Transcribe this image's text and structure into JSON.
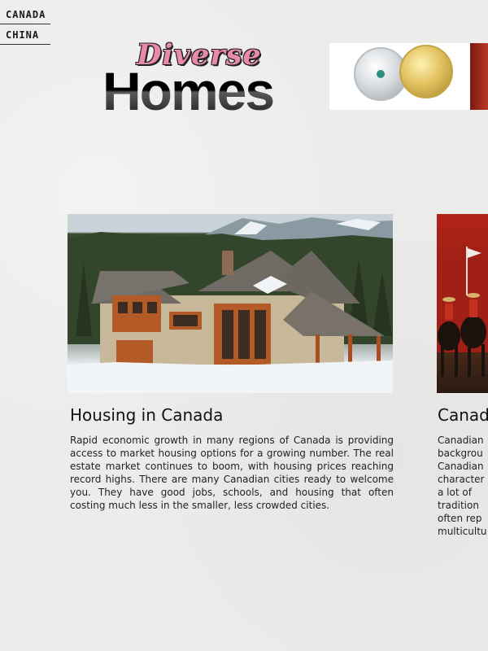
{
  "nav": {
    "items": [
      {
        "label": "CANADA"
      },
      {
        "label": "CHINA"
      }
    ]
  },
  "logo": {
    "script_text": "Diverse",
    "main_text": "Homes",
    "script_color": "#e88aa8"
  },
  "cards": [
    {
      "title": "Housing in Canada",
      "image_icon": "house-photo",
      "body": "Rapid economic growth in many regions of Canada is providing access to market housing options for a growing number. The real estate market continues to boom, with housing prices reaching record highs. There are many Canadian cities ready to welcome you. They have good jobs, schools, and housing that often costing much less in the smaller, less crowded cities."
    },
    {
      "title": "Canad",
      "image_icon": "mounties-photo",
      "lines": [
        "Canadian",
        "backgrou",
        "Canadian",
        "character",
        "a lot of",
        "tradition",
        "often rep",
        "multicultu"
      ]
    }
  ],
  "colors": {
    "background": "#ececea",
    "text": "#222222"
  }
}
